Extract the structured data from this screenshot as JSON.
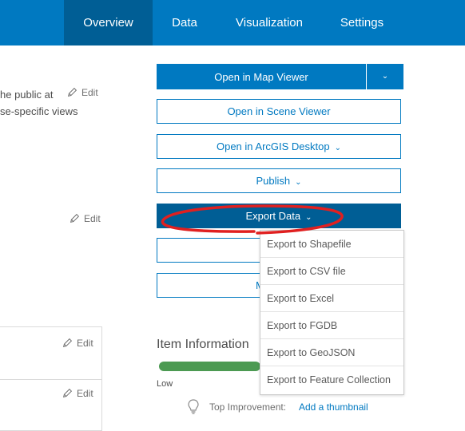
{
  "nav": {
    "tabs": [
      {
        "label": "Overview",
        "active": true
      },
      {
        "label": "Data",
        "active": false
      },
      {
        "label": "Visualization",
        "active": false
      },
      {
        "label": "Settings",
        "active": false
      }
    ]
  },
  "left": {
    "text_line1": "he public at",
    "text_line2": "se-specific views",
    "edit_label": "Edit"
  },
  "actions": {
    "map_viewer": "Open in Map Viewer",
    "scene_viewer": "Open in Scene Viewer",
    "arcgis_desktop": "Open in ArcGIS Desktop",
    "publish": "Publish",
    "export_data": "Export Data",
    "hidden_partial": "M"
  },
  "export_menu": {
    "items": [
      "Export to Shapefile",
      "Export to CSV file",
      "Export to Excel",
      "Export to FGDB",
      "Export to GeoJSON",
      "Export to Feature Collection"
    ]
  },
  "item_info": {
    "title": "Item Information",
    "level_label": "Low",
    "improvement_label": "Top Improvement:",
    "improvement_link": "Add a thumbnail"
  },
  "colors": {
    "brand": "#0079c1",
    "brand_dark": "#005e95",
    "progress": "#4c9a52",
    "annotation": "#e02020"
  },
  "icons": [
    "pencil-icon",
    "chevron-down-icon",
    "lightbulb-icon"
  ]
}
